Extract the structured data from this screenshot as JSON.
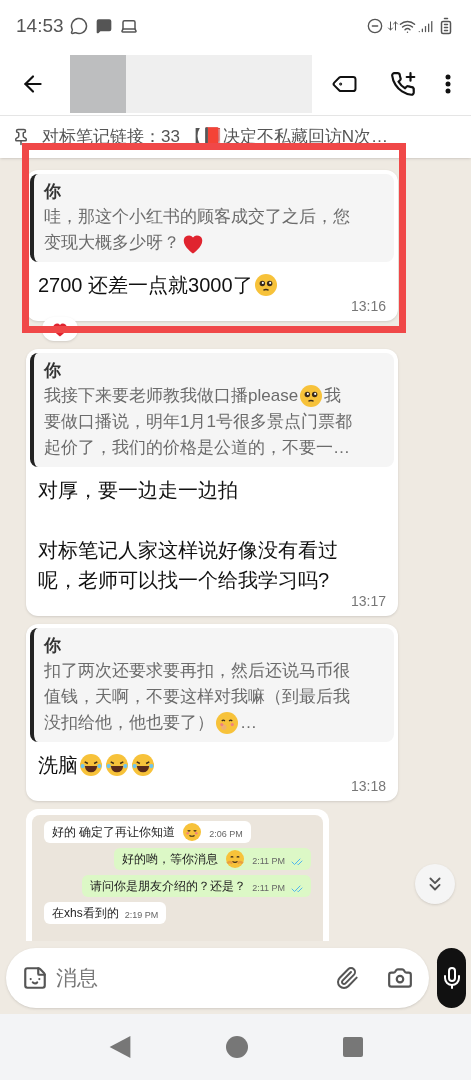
{
  "status_bar": {
    "time": "14:53"
  },
  "header": {
    "name_redacted": true
  },
  "pinned": {
    "text": "对标笔记链接：33 【📕决定不私藏回访N次…"
  },
  "highlight": {
    "shown": true
  },
  "messages": [
    {
      "quote": {
        "author": "你",
        "lines": [
          [
            {
              "kind": "text",
              "text": "哇，那这个小红书的顾客成交了之后，您"
            }
          ],
          [
            {
              "kind": "text",
              "text": "变现大概多少呀？"
            },
            {
              "kind": "heart"
            }
          ]
        ]
      },
      "body": [
        [
          {
            "kind": "text",
            "text": "2700 还差一点就3000了"
          },
          {
            "kind": "pleading"
          }
        ]
      ],
      "time": "13:16",
      "reaction": {
        "kind": "heart"
      }
    },
    {
      "quote": {
        "author": "你",
        "lines": [
          [
            {
              "kind": "text",
              "text": "我接下来要老师教我做口播please"
            },
            {
              "kind": "pleading"
            },
            {
              "kind": "text",
              "text": "我"
            }
          ],
          [
            {
              "kind": "text",
              "text": "要做口播说，明年1月1号很多景点门票都"
            }
          ],
          [
            {
              "kind": "text",
              "text": "起价了，我们的价格是公道的，不要一…"
            }
          ]
        ]
      },
      "body": [
        [
          {
            "kind": "text",
            "text": "对厚，要一边走一边拍"
          }
        ],
        [
          {
            "kind": "break"
          }
        ],
        [
          {
            "kind": "text",
            "text": "对标笔记人家这样说好像没有看过"
          }
        ],
        [
          {
            "kind": "text",
            "text": "呢，老师可以找一个给我学习吗?"
          }
        ]
      ],
      "time": "13:17"
    },
    {
      "quote": {
        "author": "你",
        "lines": [
          [
            {
              "kind": "text",
              "text": "扣了两次还要求要再扣，然后还说马币很"
            }
          ],
          [
            {
              "kind": "text",
              "text": "值钱，天啊，不要这样对我嘛（到最后我"
            }
          ],
          [
            {
              "kind": "text",
              "text": "没扣给他，他也要了）"
            },
            {
              "kind": "giggle"
            },
            {
              "kind": "text",
              "text": "…"
            }
          ]
        ]
      },
      "body": [
        [
          {
            "kind": "text",
            "text": "洗脑"
          },
          {
            "kind": "laugh"
          },
          {
            "kind": "laugh"
          },
          {
            "kind": "laugh"
          }
        ]
      ],
      "time": "13:18"
    }
  ],
  "shared_screenshot": {
    "messages": [
      {
        "kind": "incoming",
        "text": "好的 确定了再让你知道",
        "emoji": {
          "kind": "relieved"
        },
        "time": "2:06 PM"
      },
      {
        "kind": "outgoing",
        "text": "好的哟，等你消息",
        "emoji": {
          "kind": "hug"
        },
        "time": "2:11 PM",
        "read": true
      },
      {
        "kind": "outgoing",
        "text": "请问你是朋友介绍的？还是？",
        "time": "2:11 PM",
        "read": true
      },
      {
        "kind": "incoming",
        "text": "在xhs看到的",
        "time": "2:19 PM"
      }
    ]
  },
  "composer": {
    "placeholder": "消息"
  }
}
